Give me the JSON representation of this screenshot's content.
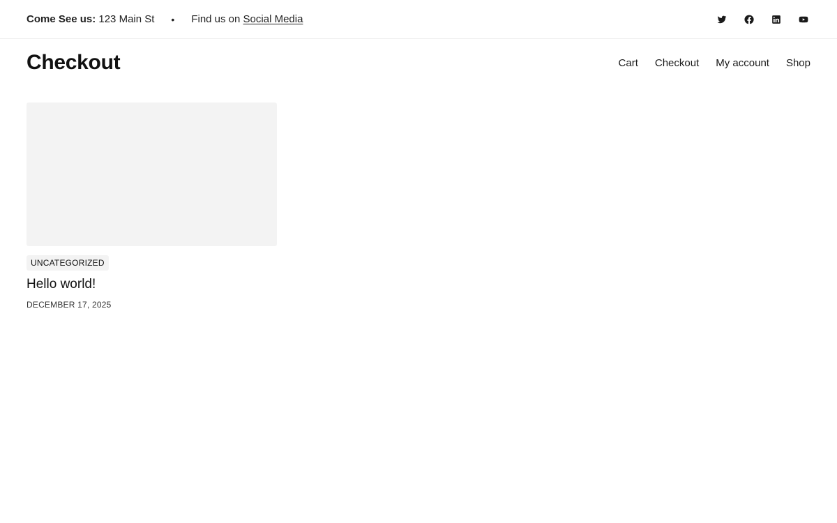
{
  "topbar": {
    "address_label": "Come See us:",
    "address_value": "123 Main St",
    "bullet": "•",
    "find_text": "Find us on",
    "social_link_text": "Social Media",
    "icons": [
      "twitter-icon",
      "facebook-icon",
      "linkedin-icon",
      "youtube-icon"
    ]
  },
  "header": {
    "site_title": "Checkout",
    "nav": [
      "Cart",
      "Checkout",
      "My account",
      "Shop"
    ]
  },
  "post": {
    "category": "UNCATEGORIZED",
    "title": "Hello world!",
    "date": "DECEMBER 17, 2025"
  }
}
